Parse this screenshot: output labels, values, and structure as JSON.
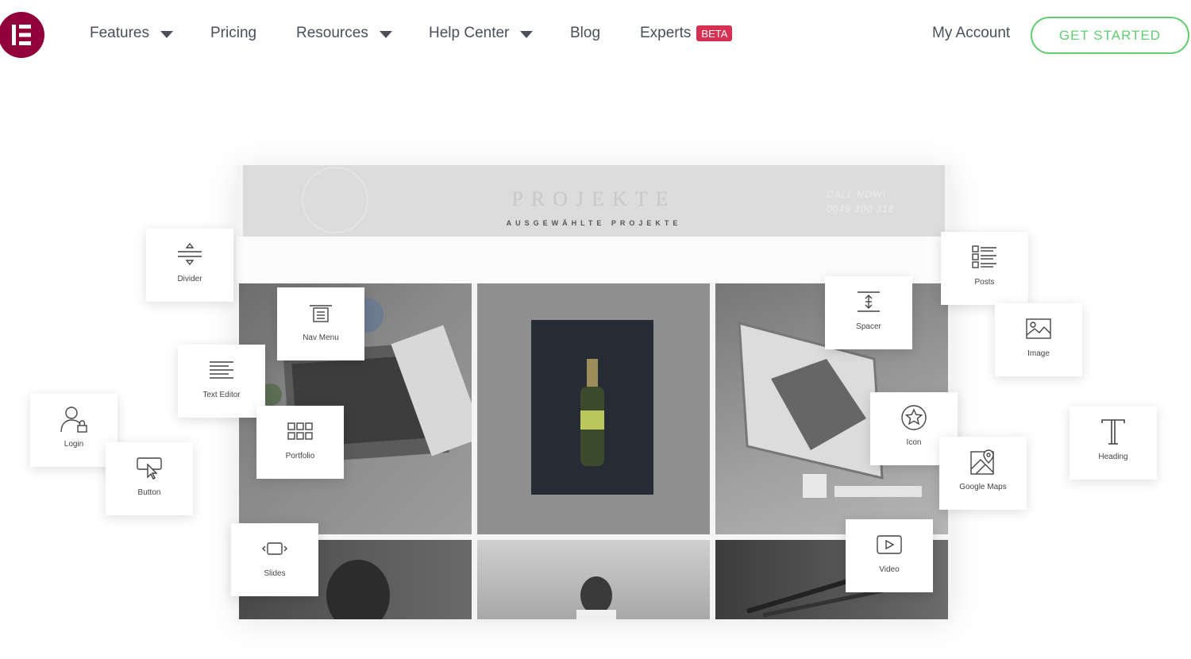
{
  "nav": {
    "logo_letter": "E",
    "items": [
      {
        "label": "Features",
        "dropdown": true
      },
      {
        "label": "Pricing",
        "dropdown": false
      },
      {
        "label": "Resources",
        "dropdown": true
      },
      {
        "label": "Help Center",
        "dropdown": true
      },
      {
        "label": "Blog",
        "dropdown": false
      },
      {
        "label": "Experts",
        "dropdown": false,
        "badge": "BETA"
      }
    ],
    "my_account": "My Account",
    "cta": "GET STARTED"
  },
  "mockup": {
    "title": "PROJEKTE",
    "subtitle": "AUSGEWÄHLTE PROJEKTE",
    "call_now": "CALL NOW!",
    "phone": "0049 300 318"
  },
  "widgets": [
    {
      "id": "divider",
      "label": "Divider",
      "icon": "divider-icon"
    },
    {
      "id": "nav-menu",
      "label": "Nav Menu",
      "icon": "nav-menu-icon"
    },
    {
      "id": "text-editor",
      "label": "Text Editor",
      "icon": "text-editor-icon"
    },
    {
      "id": "login",
      "label": "Login",
      "icon": "login-icon"
    },
    {
      "id": "portfolio",
      "label": "Portfolio",
      "icon": "portfolio-icon"
    },
    {
      "id": "button",
      "label": "Button",
      "icon": "button-icon"
    },
    {
      "id": "slides",
      "label": "Slides",
      "icon": "slides-icon"
    },
    {
      "id": "spacer",
      "label": "Spacer",
      "icon": "spacer-icon"
    },
    {
      "id": "posts",
      "label": "Posts",
      "icon": "posts-icon"
    },
    {
      "id": "image",
      "label": "Image",
      "icon": "image-icon"
    },
    {
      "id": "icon",
      "label": "Icon",
      "icon": "star-icon"
    },
    {
      "id": "google-maps",
      "label": "Google Maps",
      "icon": "google-maps-icon"
    },
    {
      "id": "heading",
      "label": "Heading",
      "icon": "heading-icon"
    },
    {
      "id": "video",
      "label": "Video",
      "icon": "video-icon"
    }
  ],
  "colors": {
    "brand": "#92003b",
    "cta_green": "#61ce70",
    "beta_badge": "#d63053"
  }
}
